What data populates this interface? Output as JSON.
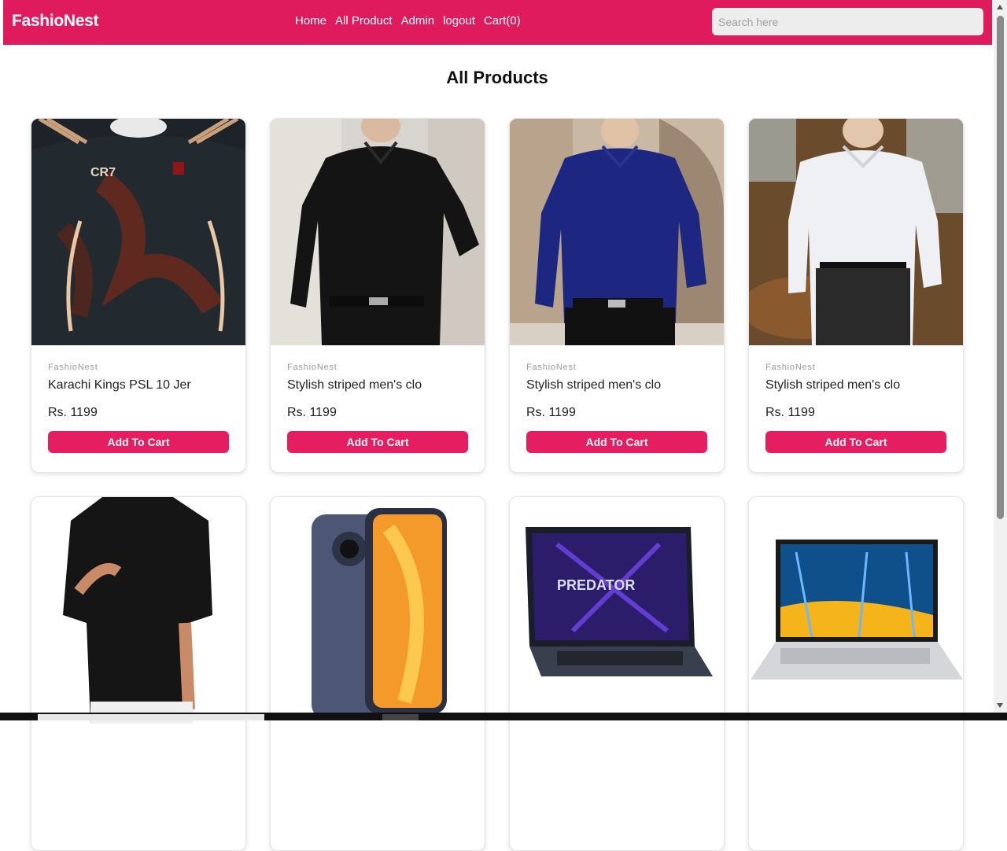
{
  "nav": {
    "brand": "FashioNest",
    "links": [
      "Home",
      "All Product",
      "Admin",
      "logout",
      "Cart(0)"
    ],
    "search_placeholder": "Search here"
  },
  "page": {
    "title": "All Products"
  },
  "products": [
    {
      "brand": "FashioNest",
      "name": "Karachi Kings PSL 10 Jer",
      "price": "Rs. 1199",
      "button": "Add To Cart",
      "image": "dark-jersey-image"
    },
    {
      "brand": "FashioNest",
      "name": "Stylish striped men's clo",
      "price": "Rs. 1199",
      "button": "Add To Cart",
      "image": "black-shirt-image"
    },
    {
      "brand": "FashioNest",
      "name": "Stylish striped men's clo",
      "price": "Rs. 1199",
      "button": "Add To Cart",
      "image": "navy-shirt-image"
    },
    {
      "brand": "FashioNest",
      "name": "Stylish striped men's clo",
      "price": "Rs. 1199",
      "button": "Add To Cart",
      "image": "white-shirt-image"
    }
  ],
  "products_row2_images": [
    "black-short-sleeve-shirt-image",
    "phone-case-image",
    "predator-laptop-image",
    "silver-laptop-image"
  ],
  "colors": {
    "brand": "#df1b5d",
    "button": "#e51d61"
  }
}
